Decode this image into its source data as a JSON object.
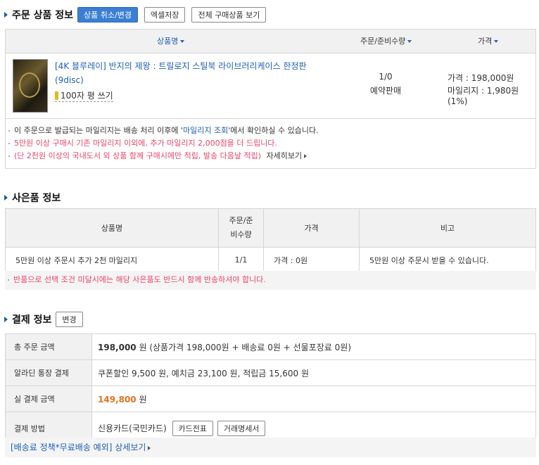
{
  "order_section": {
    "title": "주문 상품 정보",
    "cancel_button": "상품 취소/변경",
    "excel_button": "엑셀저장",
    "view_all_button": "전체 구매상품 보기",
    "headers": {
      "product": "상품명",
      "qty": "주문/준비수량",
      "price": "가격"
    },
    "item": {
      "title": "[4K 블루레이] 반지의 제왕 : 트릴로지 스틸북 라이브러리케이스 한정판 (9disc)",
      "review": "100자 평 쓰기",
      "qty": "1/0",
      "status": "예약판매",
      "price": "가격 : 198,000원",
      "mileage": "마일리지 : 1,980원 (1%)"
    },
    "notes": {
      "n1_pre": "이 주문으로 발급되는 마일리지는 배송 처리 이후에 '",
      "n1_link": "마일리지 조회",
      "n1_post": "'에서 확인하실 수 있습니다.",
      "n2": "5만원 이상 구매시 기존 마일리지 이외에, 추가 마일리지 2,000점을 더 드립니다.",
      "n3": "(단 2천원 이상의 국내도서 외 상품 함께 구매시에만 적립, 발송 다음날 적립)",
      "n3_link": "자세히보기"
    }
  },
  "gift_section": {
    "title": "사은품 정보",
    "headers": {
      "product": "상품명",
      "qty": "주문/준비수량",
      "price": "가격",
      "note": "비고"
    },
    "row": {
      "product": "5만원 이상 주문시 추가 2천 마일리지",
      "qty": "1/1",
      "price": "가격 : 0원",
      "note": "5만원 이상 주문시 받을 수 있습니다."
    },
    "warning": "반품으로 선택 조건 미달시에는 해당 사은품도 반드시 함께 반송하셔야 합니다."
  },
  "payment_section": {
    "title": "결제 정보",
    "change_button": "변경",
    "rows": {
      "total_label": "총 주문 금액",
      "total_amount": "198,000",
      "total_rest": "원 (상품가격 198,000원 + 배송료 0원 + 선물포장료 0원)",
      "account_label": "알라딘 통장 결제",
      "account_value": "쿠폰할인 9,500 원, 예치금 23,100 원, 적립금 15,600 원",
      "actual_label": "실 결제 금액",
      "actual_amount": "149,800",
      "actual_unit": "원",
      "method_label": "결제 방법",
      "method_value": "신용카드(국민카드)",
      "card_slip_button": "카드전표",
      "statement_button": "거래명세서"
    },
    "footer_link": "[배송료 정책*무료배송 예외] 상세보기"
  },
  "colors": {
    "accent_blue": "#3b7fd3",
    "link_blue": "#1f5fb3",
    "pink": "#e8456a",
    "orange": "#e8711c"
  }
}
